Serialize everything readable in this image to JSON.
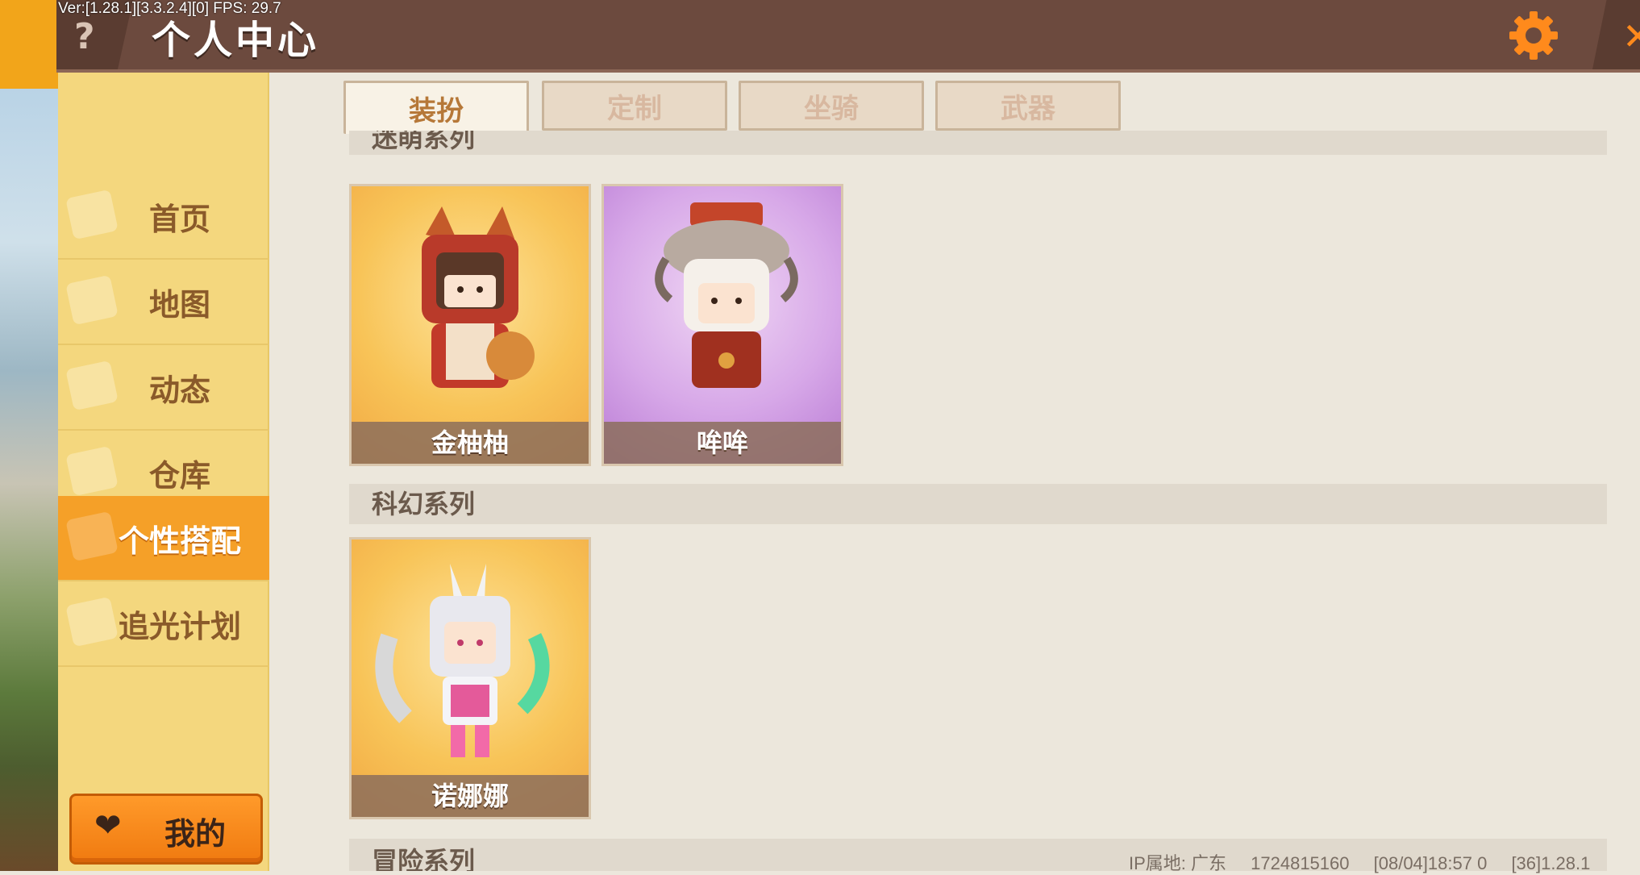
{
  "debug_overlay": "Ver:[1.28.1][3.3.2.4][0] FPS: 29.7",
  "header": {
    "title": "个人中心",
    "help_symbol": "?",
    "close_symbol": "✕"
  },
  "sidebar": {
    "items": [
      {
        "label": "首页"
      },
      {
        "label": "地图"
      },
      {
        "label": "动态"
      },
      {
        "label": "仓库"
      },
      {
        "label": "个性搭配",
        "active": true
      },
      {
        "label": "追光计划"
      }
    ],
    "mine_button": {
      "label": "我的",
      "icon": "heart-icon"
    }
  },
  "tabs": [
    {
      "label": "装扮",
      "active": true
    },
    {
      "label": "定制"
    },
    {
      "label": "坐骑"
    },
    {
      "label": "武器"
    }
  ],
  "sections": [
    {
      "title": "迷萌系列",
      "cards": [
        {
          "name": "金柚柚",
          "theme": "gold"
        },
        {
          "name": "哞哞",
          "theme": "purple"
        }
      ]
    },
    {
      "title": "科幻系列",
      "cards": [
        {
          "name": "诺娜娜",
          "theme": "gold"
        }
      ]
    },
    {
      "title": "冒险系列",
      "cards": []
    }
  ],
  "footer": {
    "ip_location": "IP属地: 广东",
    "uid": "1724815160",
    "timestamp": "[08/04]18:57 0",
    "version": "[36]1.28.1"
  },
  "colors": {
    "top_bar": "#6c4a3e",
    "sidebar": "#f4d77e",
    "active_nav": "#f5a028",
    "accent_orange": "#ff8a1c"
  }
}
